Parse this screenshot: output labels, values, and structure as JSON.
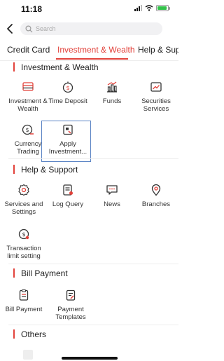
{
  "status_bar": {
    "time": "11:18"
  },
  "search": {
    "placeholder": "Search"
  },
  "tabs": [
    {
      "label": "Credit Card",
      "active": false
    },
    {
      "label": "Investment & Wealth",
      "active": true
    },
    {
      "label": "Help & Supp",
      "active": false
    }
  ],
  "sections": [
    {
      "title": "Investment & Wealth",
      "items": [
        {
          "label": "Investment & Wealth",
          "icon": "investment-wealth-icon"
        },
        {
          "label": "Time Deposit",
          "icon": "time-deposit-icon"
        },
        {
          "label": "Funds",
          "icon": "funds-icon"
        },
        {
          "label": "Securities Services",
          "icon": "securities-icon"
        },
        {
          "label": "Currency Trading",
          "icon": "currency-trading-icon"
        },
        {
          "label": "Apply Investment...",
          "icon": "apply-investment-icon"
        }
      ]
    },
    {
      "title": "Help & Support",
      "items": [
        {
          "label": "Services and Settings",
          "icon": "settings-gear-icon"
        },
        {
          "label": "Log Query",
          "icon": "log-query-icon"
        },
        {
          "label": "News",
          "icon": "news-icon"
        },
        {
          "label": "Branches",
          "icon": "location-pin-icon"
        },
        {
          "label": "Transaction limit setting",
          "icon": "transaction-limit-icon"
        }
      ]
    },
    {
      "title": "Bill Payment",
      "items": [
        {
          "label": "Bill Payment",
          "icon": "bill-payment-icon"
        },
        {
          "label": "Payment Templates",
          "icon": "payment-templates-icon"
        }
      ]
    },
    {
      "title": "Others",
      "items": []
    }
  ],
  "colors": {
    "accent": "#e2413a",
    "highlight": "#5b84c4"
  }
}
